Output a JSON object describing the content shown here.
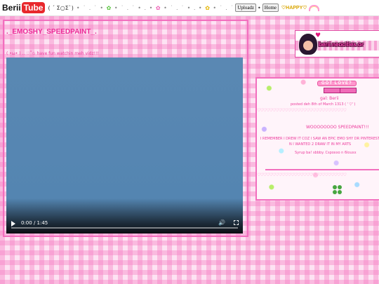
{
  "header": {
    "logo_part1": "Berii",
    "logo_part2": "Tube",
    "kaomoji": "( ´ Σ○Σ`)",
    "upload_label": "Uploadz",
    "home_label": "Home",
    "happy_label": "♡HAPPY♡"
  },
  "video": {
    "title": "._EMOSHY_SPEEDPAINT_.",
    "subtitle": "( •ω• ) .. ♡˚✩ have fun watchin meh vidz!!!",
    "time_display": "0:00 / 1:45",
    "progress": 0
  },
  "banner": {
    "text": "berii.neocities.or"
  },
  "sidebar": {
    "got_love": "GOT LOVE?",
    "author": "gal: Berii",
    "posted": "posted deh 8th of March 1313 ( ' ▽' )",
    "hearts": "♡♡♡♡♡♡♡♡♡♡♡♡♡♡♡♡♡♡♡♡♡♡♡♡♡♡♡♡♡",
    "description_title": "WOOOOOOOO SPEEDPAINT!!!",
    "description": "I REMEMBER I DREW IT COZ I SAW AN EPIC EMO SHY DR PINTEREST N I WANTED 2 DRAW IT IN MY ARTS",
    "syrup_line": "Syrup ba! sbbby. Cspoxxo n 6louxx"
  },
  "colors": {
    "pink_border": "#f26fbe",
    "pink_text": "#ec3b9c",
    "logo_red": "#e8282c"
  }
}
